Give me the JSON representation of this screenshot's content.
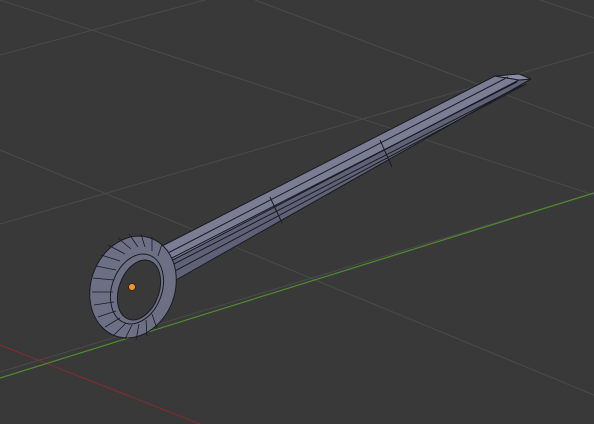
{
  "viewport": {
    "background": "#393939",
    "grid_color": "#4a4a4a",
    "x_axis_color": "#7a2e2e",
    "y_axis_color": "#4f8a2f",
    "mesh_face_color": "#6d6f85",
    "mesh_edge_color": "#1b1b22",
    "origin_color": "#f0932b"
  },
  "scene": {
    "object_icon": "sword-mesh-icon",
    "origin_icon": "object-origin-icon"
  }
}
